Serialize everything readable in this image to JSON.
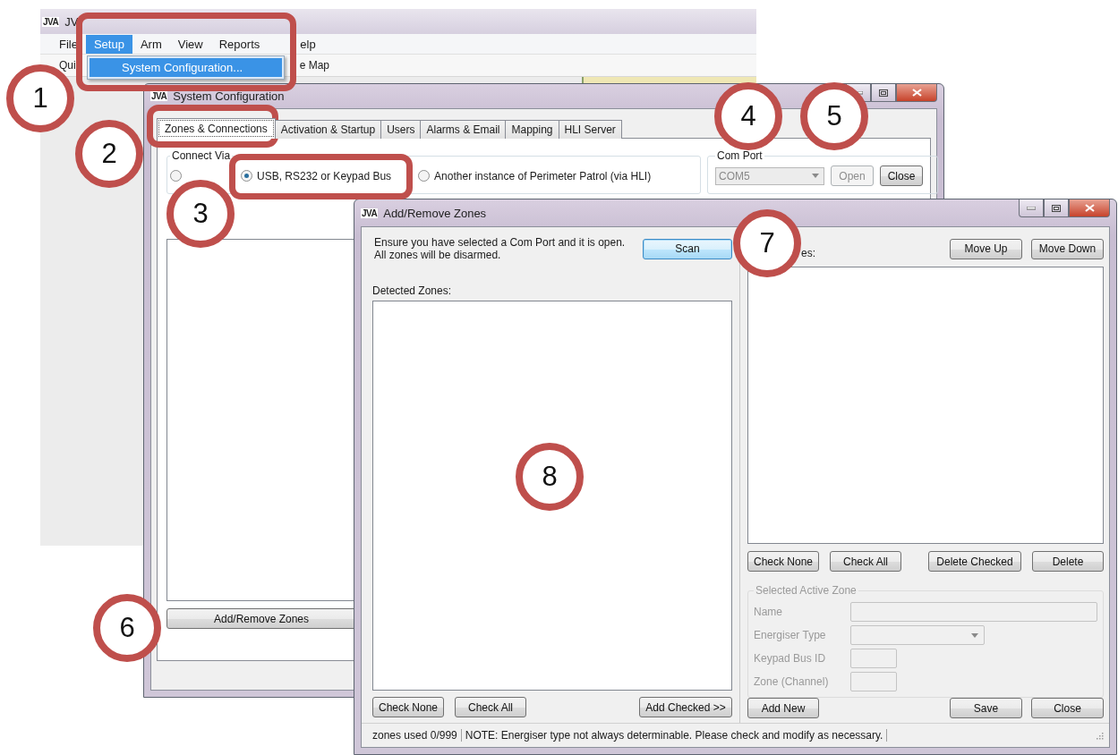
{
  "app_window": {
    "logo": "JVA",
    "title": "JV",
    "menu": [
      {
        "label": "File",
        "selected": false
      },
      {
        "label": "Setup",
        "selected": true
      },
      {
        "label": "Arm",
        "selected": false
      },
      {
        "label": "View",
        "selected": false
      },
      {
        "label": "Reports",
        "selected": false
      },
      {
        "label": "elp",
        "selected": false
      }
    ],
    "dropdown": [
      "System Configuration..."
    ],
    "toolbar": [
      "Qui",
      "e Map"
    ]
  },
  "config_window": {
    "logo": "JVA",
    "title": "System Configuration",
    "tabs": [
      {
        "label": "Zones & Connections",
        "selected": true
      },
      {
        "label": "Activation & Startup",
        "selected": false
      },
      {
        "label": "Users",
        "selected": false
      },
      {
        "label": "Alarms & Email",
        "selected": false
      },
      {
        "label": "Mapping",
        "selected": false
      },
      {
        "label": "HLI Server",
        "selected": false
      }
    ],
    "connect_via": {
      "label": "Connect Via",
      "options": [
        {
          "selected": false
        },
        {
          "label": "USB, RS232 or Keypad Bus",
          "selected": true
        },
        {
          "label": "Another instance of Perimeter Patrol (via HLI)",
          "selected": false
        }
      ]
    },
    "com_port": {
      "label": "Com Port",
      "value": "COM5",
      "disabled": true,
      "buttons": [
        {
          "label": "Open",
          "disabled": true
        },
        {
          "label": "Close",
          "disabled": false
        }
      ]
    },
    "add_remove_button": "Add/Remove Zones"
  },
  "zones_window": {
    "logo": "JVA",
    "title": "Add/Remove Zones",
    "notice": [
      "Ensure you have selected a Com Port and it is open.",
      "All zones will be disarmed."
    ],
    "scan_button": {
      "label": "Scan",
      "focused": true
    },
    "detected_label": "Detected Zones:",
    "left_buttons": [
      "Check None",
      "Check All"
    ],
    "add_checked_button": "Add Checked >>",
    "active_label": "es:",
    "move_buttons": [
      "Move Up",
      "Move Down"
    ],
    "list_buttons": [
      "Check None",
      "Check All",
      "Delete Checked",
      "Delete"
    ],
    "selected_zone": {
      "label": "Selected Active Zone",
      "fields": [
        {
          "label": "Name",
          "kind": "text",
          "disabled": true
        },
        {
          "label": "Energiser Type",
          "kind": "combo",
          "disabled": true
        },
        {
          "label": "Keypad Bus ID",
          "kind": "short",
          "disabled": true
        },
        {
          "label": "Zone (Channel)",
          "kind": "short",
          "disabled": true
        }
      ]
    },
    "add_new_button": "Add New",
    "footer_buttons": [
      "Save",
      "Close"
    ],
    "status_bar": [
      "zones used 0/999",
      "NOTE: Energiser type not always determinable. Please check and modify as necessary."
    ]
  },
  "callouts": [
    {
      "number": "1"
    },
    {
      "number": "2"
    },
    {
      "number": "3"
    },
    {
      "number": "4"
    },
    {
      "number": "5"
    },
    {
      "number": "6"
    },
    {
      "number": "7"
    },
    {
      "number": "8"
    }
  ]
}
